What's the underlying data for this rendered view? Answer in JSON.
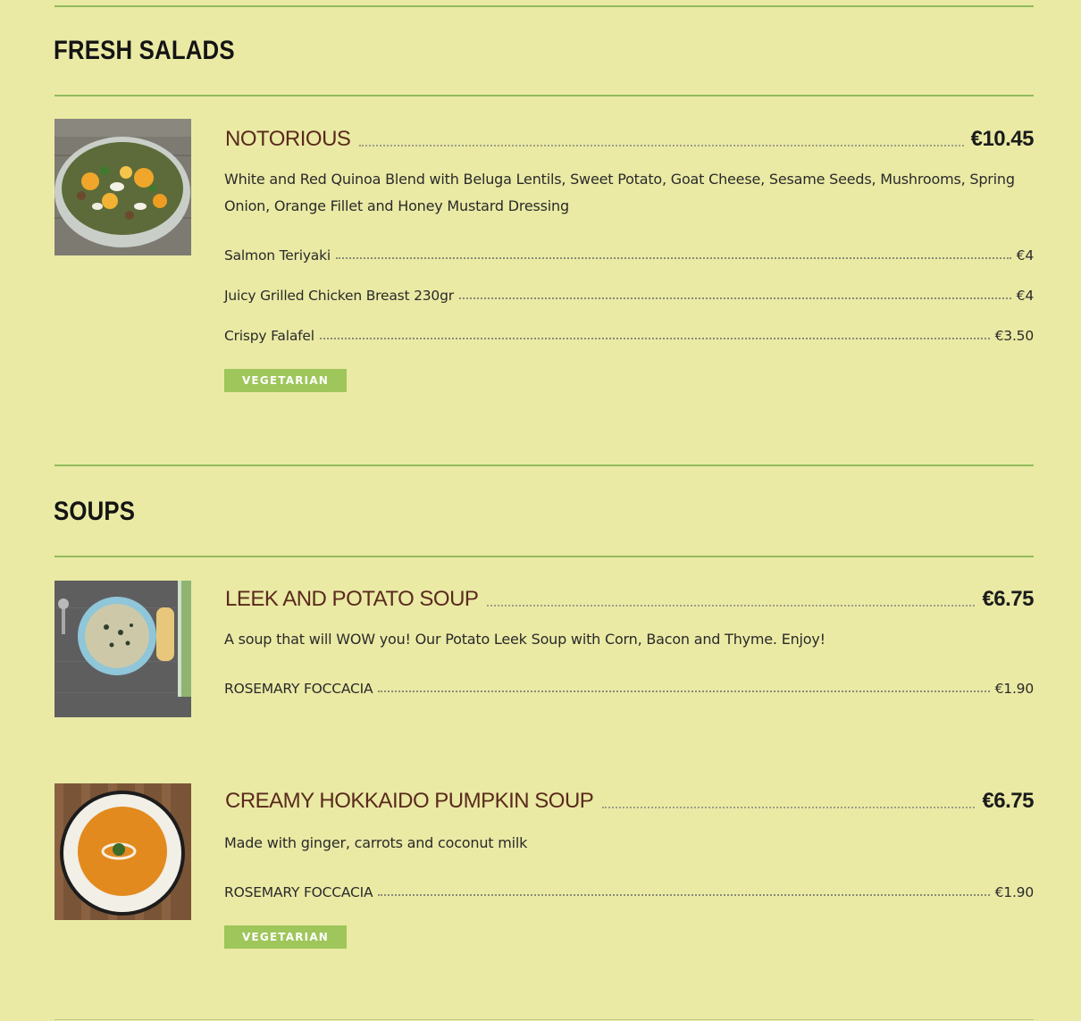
{
  "colors": {
    "background": "#eaeaa5",
    "rule": "#93bb5c",
    "item_name": "#5a2a1c",
    "badge": "#9ec65a"
  },
  "sections": [
    {
      "title": "FRESH SALADS",
      "items": [
        {
          "name": "NOTORIOUS",
          "price": "€10.45",
          "description": "White and Red Quinoa Blend with Beluga Lentils, Sweet Potato, Goat Cheese, Sesame Seeds, Mushrooms, Spring Onion, Orange Fillet and Honey Mustard Dressing",
          "image_icon": "salad-bowl-photo",
          "addons": [
            {
              "name": "Salmon Teriyaki",
              "price": "€4"
            },
            {
              "name": "Juicy Grilled Chicken Breast 230gr",
              "price": "€4"
            },
            {
              "name": "Crispy Falafel",
              "price": "€3.50"
            }
          ],
          "badge": "VEGETARIAN"
        }
      ]
    },
    {
      "title": "SOUPS",
      "items": [
        {
          "name": "LEEK AND POTATO SOUP",
          "price": "€6.75",
          "description": "A soup that will WOW you! Our Potato Leek Soup with Corn, Bacon and Thyme. Enjoy!",
          "image_icon": "leek-soup-photo",
          "addons": [
            {
              "name": "ROSEMARY FOCCACIA",
              "price": "€1.90"
            }
          ]
        },
        {
          "name": "CREAMY HOKKAIDO PUMPKIN SOUP",
          "price": "€6.75",
          "description": "Made with ginger, carrots and coconut milk",
          "image_icon": "pumpkin-soup-photo",
          "addons": [
            {
              "name": "ROSEMARY FOCCACIA",
              "price": "€1.90"
            }
          ],
          "badge": "VEGETARIAN"
        }
      ]
    }
  ]
}
